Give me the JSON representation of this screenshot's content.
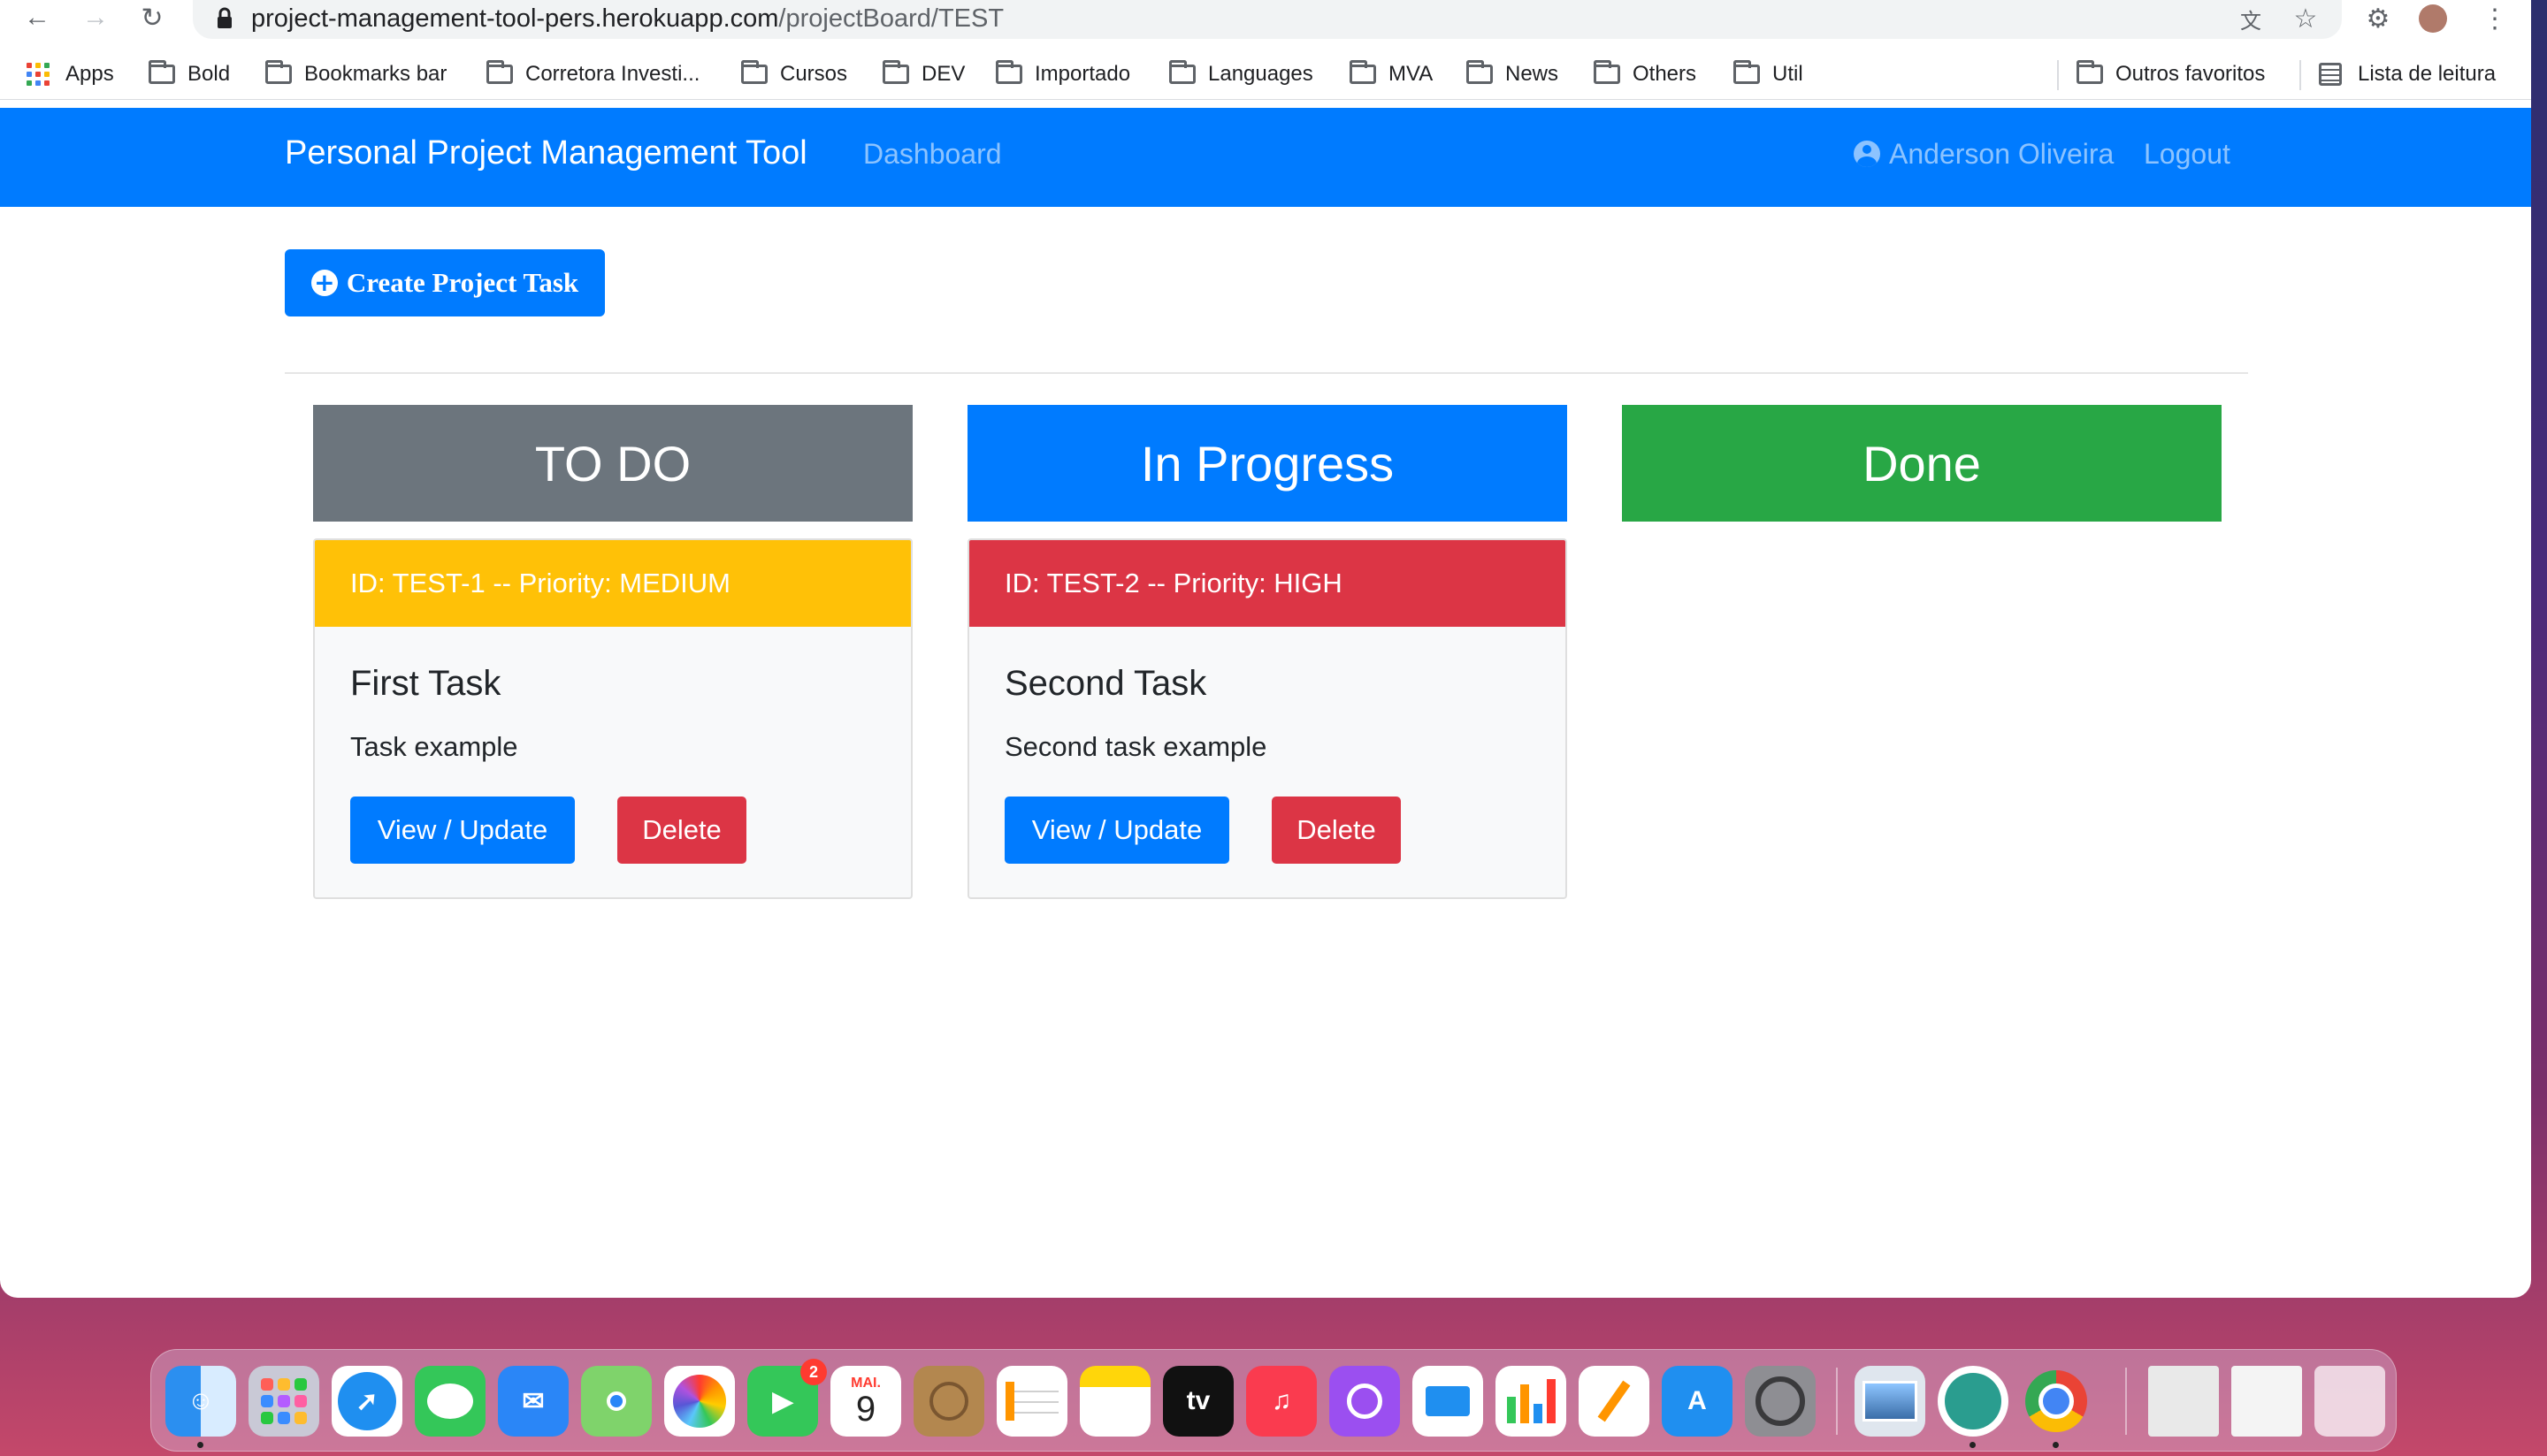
{
  "browser": {
    "url_host": "project-management-tool-pers.herokuapp.com",
    "url_path": "/projectBoard/TEST",
    "bookmarks": [
      {
        "label": "Apps",
        "icon": "apps-grid-icon"
      },
      {
        "label": "Bold",
        "icon": "folder-icon"
      },
      {
        "label": "Bookmarks bar",
        "icon": "folder-icon"
      },
      {
        "label": "Corretora Investi...",
        "icon": "folder-icon"
      },
      {
        "label": "Cursos",
        "icon": "folder-icon"
      },
      {
        "label": "DEV",
        "icon": "folder-icon"
      },
      {
        "label": "Importado",
        "icon": "folder-icon"
      },
      {
        "label": "Languages",
        "icon": "folder-icon"
      },
      {
        "label": "MVA",
        "icon": "folder-icon"
      },
      {
        "label": "News",
        "icon": "folder-icon"
      },
      {
        "label": "Others",
        "icon": "folder-icon"
      },
      {
        "label": "Util",
        "icon": "folder-icon"
      },
      {
        "label": "Outros favoritos",
        "icon": "folder-icon"
      },
      {
        "label": "Lista de leitura",
        "icon": "reading-list-icon"
      }
    ]
  },
  "navbar": {
    "brand": "Personal Project Management Tool",
    "dashboard": "Dashboard",
    "user": "Anderson Oliveira",
    "logout": "Logout"
  },
  "create_button": "Create Project Task",
  "columns": [
    {
      "title": "TO DO",
      "color": "#6c757d"
    },
    {
      "title": "In Progress",
      "color": "#007bff"
    },
    {
      "title": "Done",
      "color": "#28a745"
    }
  ],
  "tasks": [
    {
      "header": "ID: TEST-1 -- Priority: MEDIUM",
      "header_color": "#ffc107",
      "title": "First Task",
      "description": "Task example",
      "view_label": "View / Update",
      "delete_label": "Delete"
    },
    {
      "header": "ID: TEST-2 -- Priority: HIGH",
      "header_color": "#dc3545",
      "title": "Second Task",
      "description": "Second task example",
      "view_label": "View / Update",
      "delete_label": "Delete"
    }
  ],
  "colors": {
    "primary": "#007bff",
    "danger": "#dc3545",
    "warning": "#ffc107",
    "success": "#28a745",
    "secondary": "#6c757d"
  },
  "dock": {
    "apps": [
      "Finder",
      "Launchpad",
      "Safari",
      "Messages",
      "Mail",
      "Maps",
      "Photos",
      "FaceTime",
      "Calendar",
      "Contacts",
      "Reminders",
      "Notes",
      "TV",
      "Music",
      "Podcasts",
      "Keynote",
      "Numbers",
      "Pages",
      "App Store",
      "System Preferences",
      "Preview",
      "Mountain app",
      "Chrome",
      "Documents",
      "Downloads",
      "Trash"
    ],
    "facetime_badge": "2",
    "calendar_month": "MAI.",
    "calendar_day": "9",
    "tv_label": "tv"
  }
}
